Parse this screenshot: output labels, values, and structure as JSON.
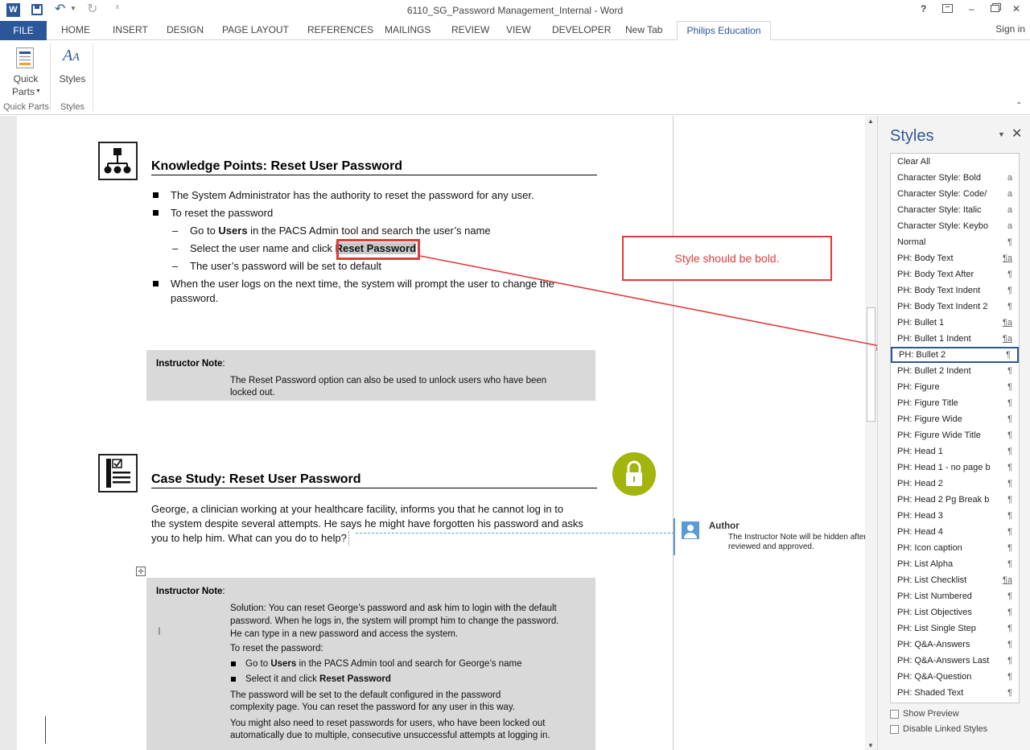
{
  "window": {
    "title": "6110_SG_Password Management_Internal - Word",
    "help": "?",
    "min": "–",
    "close": "✕"
  },
  "tabs": {
    "file": "FILE",
    "home": "HOME",
    "insert": "INSERT",
    "design": "DESIGN",
    "page_layout": "PAGE LAYOUT",
    "references": "REFERENCES",
    "mailings": "MAILINGS",
    "review": "REVIEW",
    "view": "VIEW",
    "developer": "DEVELOPER",
    "new_tab": "New Tab",
    "philips": "Philips Education",
    "sign_in": "Sign in"
  },
  "ribbon": {
    "quick_parts_line1": "Quick",
    "quick_parts_line2": "Parts",
    "styles_btn": "Styles",
    "group_quick_parts": "Quick Parts",
    "group_styles": "Styles"
  },
  "doc": {
    "kp_heading": "Knowledge Points: Reset User Password",
    "kp_b1": "The System Administrator has the authority to reset the password for any user.",
    "kp_b2": "To reset the password",
    "kp_s1_pre": "Go to ",
    "kp_s1_bold": "Users",
    "kp_s1_post": " in the PACS Admin tool and search the user’s name",
    "kp_s2_pre": "Select the user name and click ",
    "kp_s2_bold": "Reset Password",
    "kp_s3": "The user’s password will be set to default",
    "kp_b3_l1": "When the user logs on the next time, the system will prompt the user to change the",
    "kp_b3_l2": "password.",
    "dash": "–",
    "note1_title": "Instructor Note",
    "colon": ":",
    "note1_l1": "The Reset Password option can also be used to unlock users who have been",
    "note1_l2": "locked out.",
    "cs_heading": "Case Study: Reset User Password",
    "cs_l1": "George, a clinician working at your healthcare facility, informs you that he cannot log in to",
    "cs_l2": "the system despite several attempts. He says he might have forgotten his password and asks",
    "cs_l3": "you to help him. What can you do to help?",
    "note2_title": "Instructor Note",
    "note2_l1": "Solution: You can reset George’s password and ask him to login with the default",
    "note2_l2": "password. When he logs in, the system will prompt him to change the password.",
    "note2_l3": "He can type in a new password and access the system.",
    "note2_l4": " To reset the password:",
    "note2_b1_pre": "Go to ",
    "note2_b1_bold": "Users",
    "note2_b1_post": " in the PACS Admin tool and search for George’s name",
    "note2_b2_pre": "Select it and click ",
    "note2_b2_bold": "Reset Password",
    "note2_l5": "The password will be set to the default configured in the password",
    "note2_l6": "complexity page. You can reset the password for any user in this way.",
    "note2_l7": " You might also need to reset passwords for users, who have been locked out",
    "note2_l8": "automatically due to multiple, consecutive unsuccessful attempts at logging in."
  },
  "comment": {
    "author": "Author",
    "l1": "The Instructor Note will be hidden after",
    "l2": "reviewed and approved."
  },
  "callout": {
    "text": "Style should be bold."
  },
  "styles_pane": {
    "title": "Styles",
    "items": [
      {
        "name": "Clear All",
        "mark": ""
      },
      {
        "name": "Character Style: Bold",
        "mark": "a"
      },
      {
        "name": "Character Style: Code/",
        "mark": "a"
      },
      {
        "name": "Character Style: Italic",
        "mark": "a"
      },
      {
        "name": "Character Style: Keybo",
        "mark": "a"
      },
      {
        "name": "Normal",
        "mark": "¶"
      },
      {
        "name": "PH: Body Text",
        "mark": "¶a"
      },
      {
        "name": "PH: Body Text After",
        "mark": "¶"
      },
      {
        "name": "PH: Body Text Indent",
        "mark": "¶"
      },
      {
        "name": "PH: Body Text Indent 2",
        "mark": "¶"
      },
      {
        "name": "PH: Bullet 1",
        "mark": "¶a"
      },
      {
        "name": "PH: Bullet 1 Indent",
        "mark": "¶a"
      },
      {
        "name": "PH: Bullet 2",
        "mark": "¶"
      },
      {
        "name": "PH: Bullet 2 Indent",
        "mark": "¶"
      },
      {
        "name": "PH: Figure",
        "mark": "¶"
      },
      {
        "name": "PH: Figure Title",
        "mark": "¶"
      },
      {
        "name": "PH: Figure Wide",
        "mark": "¶"
      },
      {
        "name": "PH: Figure Wide Title",
        "mark": "¶"
      },
      {
        "name": "PH: Head 1",
        "mark": "¶"
      },
      {
        "name": "PH: Head 1 - no page b",
        "mark": "¶"
      },
      {
        "name": "PH: Head 2",
        "mark": "¶"
      },
      {
        "name": "PH: Head 2 Pg Break b",
        "mark": "¶"
      },
      {
        "name": "PH: Head 3",
        "mark": "¶"
      },
      {
        "name": "PH: Head 4",
        "mark": "¶"
      },
      {
        "name": "PH: Icon caption",
        "mark": "¶"
      },
      {
        "name": "PH: List Alpha",
        "mark": "¶"
      },
      {
        "name": "PH: List Checklist",
        "mark": "¶a"
      },
      {
        "name": "PH: List Numbered",
        "mark": "¶"
      },
      {
        "name": "PH: List Objectives",
        "mark": "¶"
      },
      {
        "name": "PH: List Single Step",
        "mark": "¶"
      },
      {
        "name": "PH: Q&A-Answers",
        "mark": "¶"
      },
      {
        "name": "PH: Q&A-Answers Last",
        "mark": "¶"
      },
      {
        "name": "PH: Q&A-Question",
        "mark": "¶"
      },
      {
        "name": "PH: Shaded Text",
        "mark": "¶"
      }
    ],
    "selected": "PH: Bullet 2",
    "show_preview": "Show Preview",
    "disable_linked": "Disable Linked Styles"
  },
  "colors": {
    "accent": "#2b579a",
    "callout_red": "#e03b3b",
    "lock_green": "#a3b40c",
    "note_gray": "#d9d9d9"
  }
}
